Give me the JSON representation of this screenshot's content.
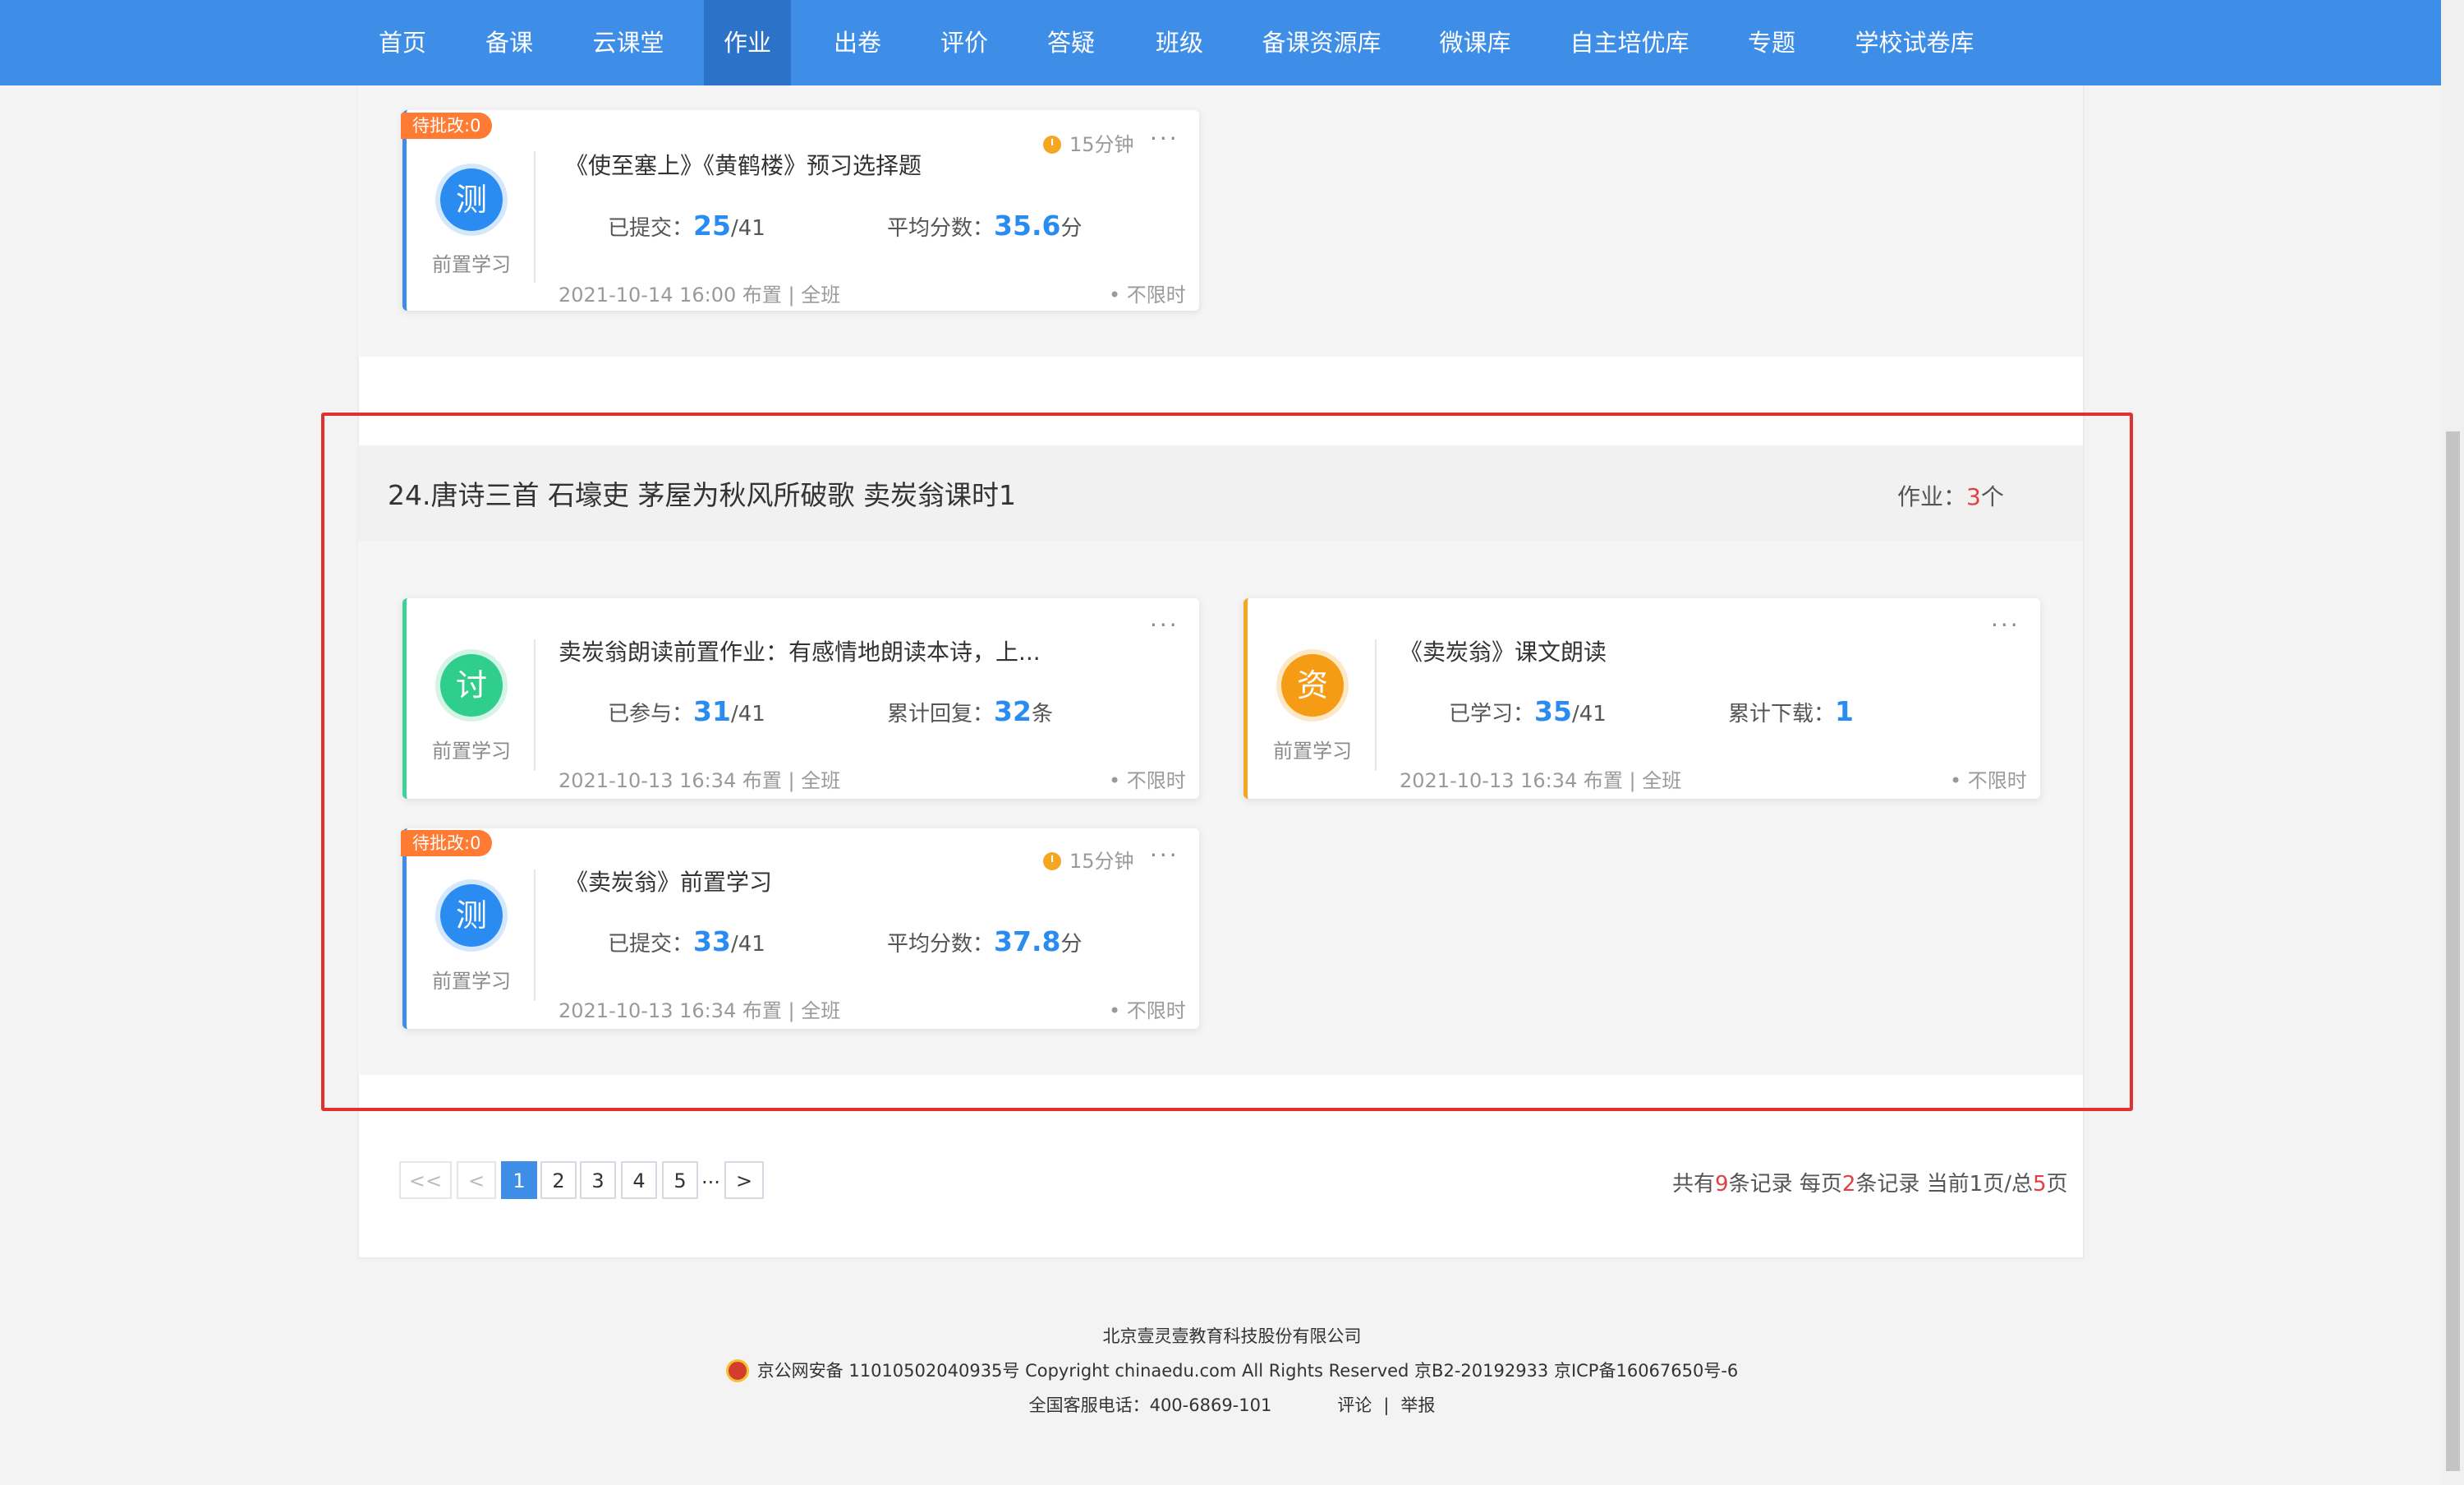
{
  "nav": {
    "items": [
      "首页",
      "备课",
      "云课堂",
      "作业",
      "出卷",
      "评价",
      "答疑",
      "班级",
      "备课资源库",
      "微课库",
      "自主培优库",
      "专题",
      "学校试卷库"
    ],
    "active": "作业"
  },
  "prev_card": {
    "pending": "待批改:0",
    "badge": "测",
    "type": "前置学习",
    "title": "《使至塞上》《黄鹤楼》预习选择题",
    "duration": "15分钟",
    "stat1_label": "已提交：",
    "stat1_value": "25",
    "stat1_total": "/41",
    "stat2_label": "平均分数：",
    "stat2_value": "35.6",
    "stat2_unit": "分",
    "meta": "2021-10-14 16:00 布置 | 全班",
    "limit": "• 不限时"
  },
  "lesson": {
    "title": "24.唐诗三首 石壕吏 茅屋为秋风所破歌 卖炭翁课时1",
    "count_label": "作业：",
    "count_value": "3",
    "count_unit": "个"
  },
  "cards": {
    "discuss": {
      "badge": "讨",
      "type": "前置学习",
      "title": "卖炭翁朗读前置作业：有感情地朗读本诗，上...",
      "stat1_label": "已参与：",
      "stat1_value": "31",
      "stat1_total": "/41",
      "stat2_label": "累计回复：",
      "stat2_value": "32",
      "stat2_unit": "条",
      "meta": "2021-10-13 16:34 布置 | 全班",
      "limit": "• 不限时"
    },
    "resource": {
      "badge": "资",
      "type": "前置学习",
      "title": "《卖炭翁》课文朗读",
      "stat1_label": "已学习：",
      "stat1_value": "35",
      "stat1_total": "/41",
      "stat2_label": "累计下载：",
      "stat2_value": "1",
      "meta": "2021-10-13 16:34 布置 | 全班",
      "limit": "• 不限时"
    },
    "test": {
      "pending": "待批改:0",
      "badge": "测",
      "type": "前置学习",
      "title": "《卖炭翁》前置学习",
      "duration": "15分钟",
      "stat1_label": "已提交：",
      "stat1_value": "33",
      "stat1_total": "/41",
      "stat2_label": "平均分数：",
      "stat2_value": "37.8",
      "stat2_unit": "分",
      "meta": "2021-10-13 16:34 布置 | 全班",
      "limit": "• 不限时"
    }
  },
  "more_icon": "···",
  "pagination": {
    "first": "<<",
    "prev": "<",
    "pages": [
      "1",
      "2",
      "3",
      "4",
      "5"
    ],
    "current": "1",
    "ellipsis": "...",
    "next": ">",
    "info": {
      "t1": "共有",
      "records": "9",
      "t2": "条记录 每页",
      "per_page": "2",
      "t3": "条记录 当前",
      "current": "1",
      "t4": "页/总",
      "total": "5",
      "t5": "页"
    }
  },
  "footer": {
    "company": "北京壹灵壹教育科技股份有限公司",
    "license": "京公网安备 11010502040935号 Copyright chinaedu.com All Rights Reserved 京B2-20192933 京ICP备16067650号-6",
    "phone": "全国客服电话：400-6869-101",
    "comment": "评论",
    "sep": "|",
    "report": "举报"
  }
}
